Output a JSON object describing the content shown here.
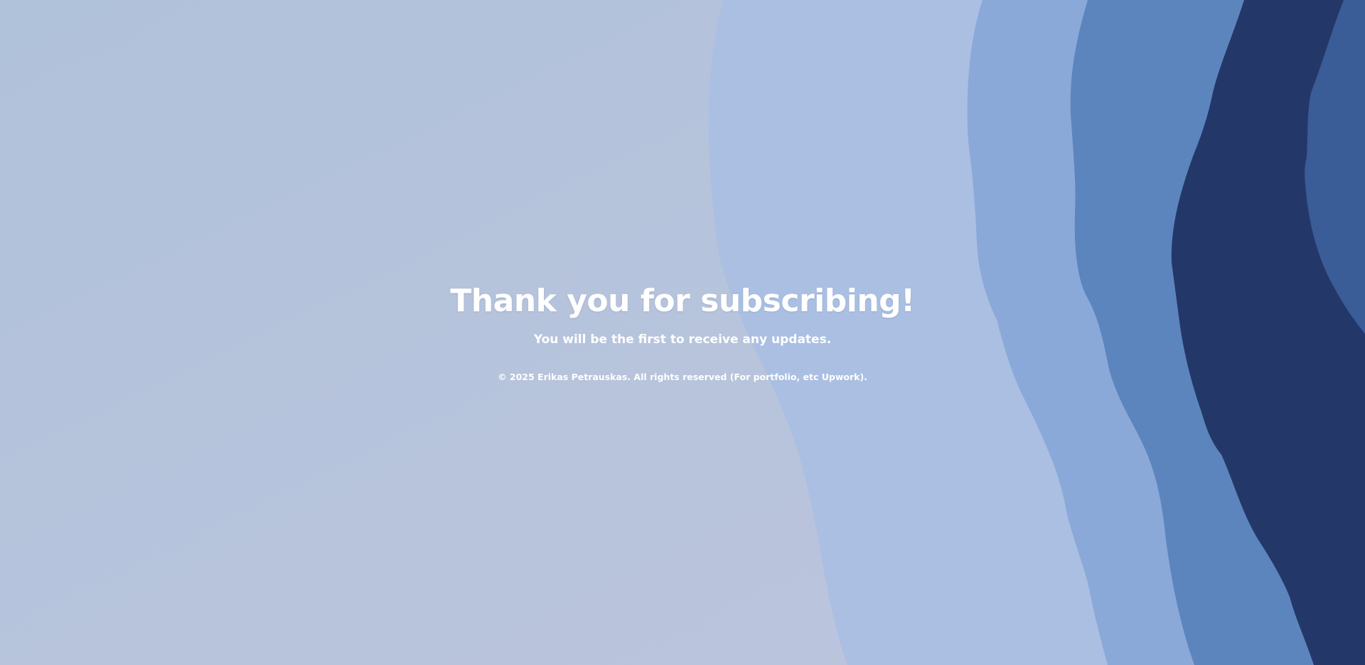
{
  "page": {
    "title": "Thank you for subscribing!",
    "subtitle": "You will be the first to receive any updates.",
    "footer": "© 2025 Erikas Petrauskas. All rights reserved (For portfolio, etc Upwork)."
  },
  "colors": {
    "background": "#b6c3da",
    "wave_light": "#aabfe2",
    "wave_mid": "#88a8d8",
    "wave_steel": "#5a82bb",
    "wave_navy": "#233869",
    "wave_blue": "#3a5d98",
    "text": "#ffffff"
  }
}
